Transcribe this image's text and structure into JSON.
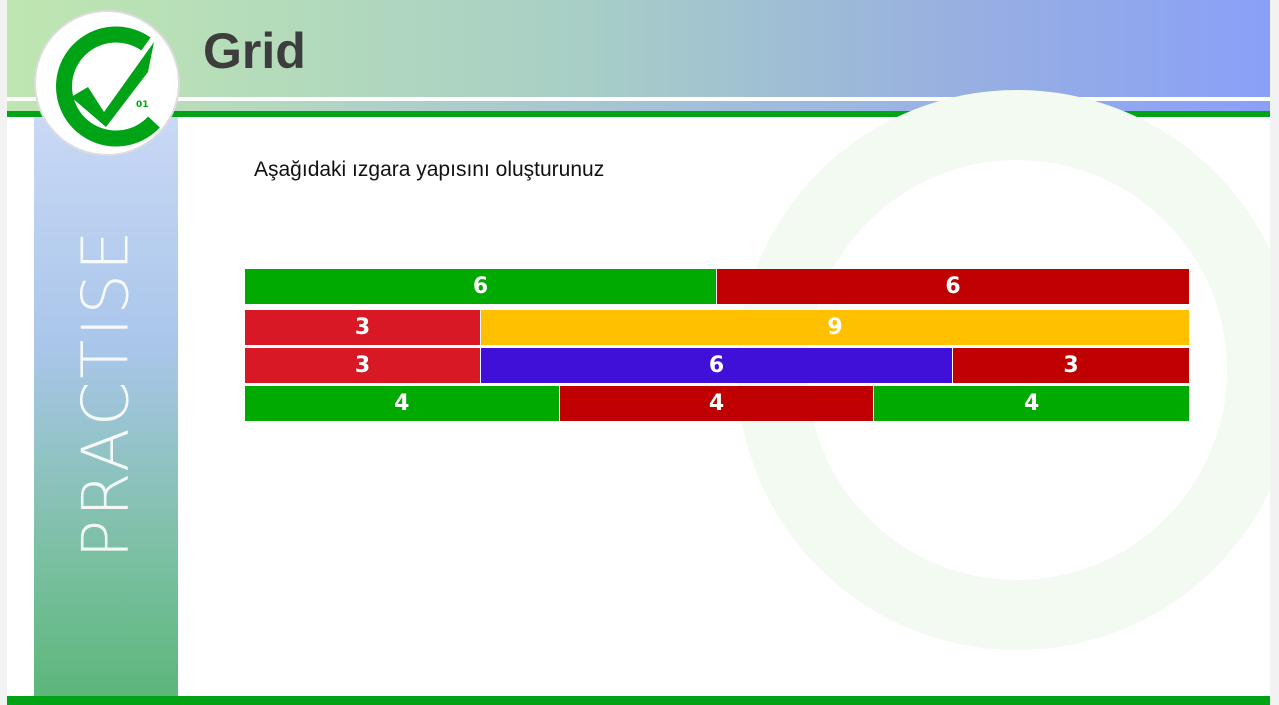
{
  "header": {
    "title": "Grid"
  },
  "logo": {
    "text": "01"
  },
  "sidebar": {
    "label": "PRACTISE"
  },
  "main": {
    "instruction": "Aşağıdaki ızgara yapısını oluşturunuz"
  },
  "colors": {
    "green": "#00aa00",
    "dark_red": "#c00000",
    "red": "#d81824",
    "yellow": "#ffc000",
    "purple": "#4010d8"
  },
  "grid": {
    "rows": [
      {
        "cells": [
          {
            "label": "6",
            "span": 6,
            "color": "#00aa00"
          },
          {
            "label": "6",
            "span": 6,
            "color": "#c00000"
          }
        ]
      },
      {
        "cells": [
          {
            "label": "3",
            "span": 3,
            "color": "#d81824"
          },
          {
            "label": "9",
            "span": 9,
            "color": "#ffc000"
          }
        ]
      },
      {
        "cells": [
          {
            "label": "3",
            "span": 3,
            "color": "#d81824"
          },
          {
            "label": "6",
            "span": 6,
            "color": "#4010d8"
          },
          {
            "label": "3",
            "span": 3,
            "color": "#c00000"
          }
        ]
      },
      {
        "cells": [
          {
            "label": "4",
            "span": 4,
            "color": "#00aa00"
          },
          {
            "label": "4",
            "span": 4,
            "color": "#c00000"
          },
          {
            "label": "4",
            "span": 4,
            "color": "#00aa00"
          }
        ]
      }
    ]
  }
}
